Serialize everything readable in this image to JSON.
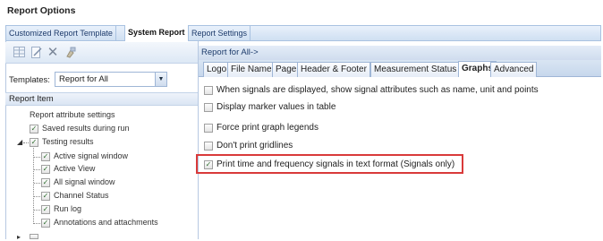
{
  "window": {
    "title": "Report Options"
  },
  "top_tabs": [
    {
      "label": "Customized Report Template",
      "active": false
    },
    {
      "label": "System Report",
      "active": true
    },
    {
      "label": "Report Settings",
      "active": false
    }
  ],
  "toolbar": {
    "icons": [
      "grid-icon",
      "document-edit-icon",
      "delete-x-icon",
      "paint-icon"
    ]
  },
  "templates": {
    "label": "Templates:",
    "selected": "Report for All"
  },
  "report_item": {
    "header": "Report Item",
    "items": [
      {
        "label": "Report attribute settings",
        "checked": null
      },
      {
        "label": "Saved results during run",
        "checked": true
      },
      {
        "label": "Testing results",
        "checked": true
      },
      {
        "label": "Active signal window",
        "checked": true
      },
      {
        "label": "Active View",
        "checked": true
      },
      {
        "label": "All signal window",
        "checked": true
      },
      {
        "label": "Channel Status",
        "checked": true
      },
      {
        "label": "Run log",
        "checked": true
      },
      {
        "label": "Annotations and attachments",
        "checked": true
      }
    ]
  },
  "right_panel": {
    "header": "Report for All->",
    "tabs": [
      {
        "label": "Logo",
        "active": false
      },
      {
        "label": "File Name",
        "active": false
      },
      {
        "label": "Page",
        "active": false
      },
      {
        "label": "Header & Footer",
        "active": false
      },
      {
        "label": "Measurement Status",
        "active": false
      },
      {
        "label": "Graphs",
        "active": true
      },
      {
        "label": "Advanced",
        "active": false
      }
    ],
    "options": [
      {
        "label": "When signals are displayed, show signal attributes such as name, unit and points",
        "checked": false
      },
      {
        "label": "Display marker values in table",
        "checked": false
      },
      {
        "label": "Force print graph legends",
        "checked": false
      },
      {
        "label": "Don't print gridlines",
        "checked": false
      },
      {
        "label": "Print time and frequency signals in text format (Signals only)",
        "checked": true
      }
    ]
  },
  "colors": {
    "highlight": "#d93a3a",
    "tab_border": "#a9c2e1",
    "header_text": "#1d3b6b"
  }
}
